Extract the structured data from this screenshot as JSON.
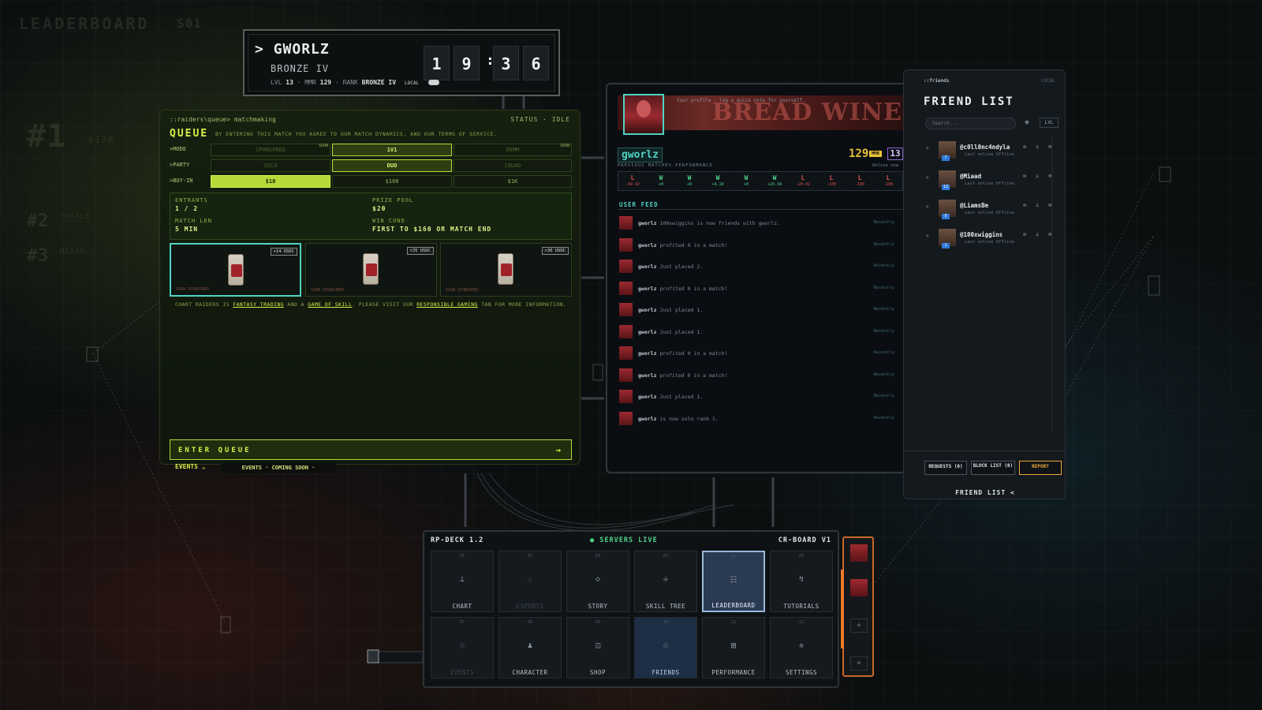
{
  "header": {
    "name": "GWORLZ",
    "rank_title": "BRONZE IV",
    "lvl_label": "LVL",
    "lvl": "13",
    "mmr_label": "MMR",
    "mmr": "129",
    "rank_label": "RANK",
    "rank": "BRONZE IV",
    "clock": [
      "1",
      "9",
      "3",
      "6"
    ],
    "local_label": "LOCAL"
  },
  "queue": {
    "path": "::raiders\\queue> matchmaking",
    "status": "STATUS · IDLE",
    "title": "QUEUE",
    "terms": "BY ENTERING THIS MATCH YOU AGREE TO OUR MATCH DYNAMICS, AND OUR TERMS OF SERVICE.",
    "rows": [
      {
        "label": ">MODE",
        "options": [
          "SPONSORED",
          "1V1",
          "DEMM"
        ],
        "tags": [
          "SOON",
          "",
          "SOON"
        ],
        "selected": 1
      },
      {
        "label": ">PARTY",
        "options": [
          "SOLO",
          "DUO",
          "SQUAD"
        ],
        "tags": [
          "",
          "",
          ""
        ],
        "selected": 1
      },
      {
        "label": ">BUY-IN",
        "options": [
          "$10",
          "$100",
          "$1K"
        ],
        "tags": [
          "",
          "",
          ""
        ],
        "selected": 0
      }
    ],
    "entrants_label": "ENTRANTS",
    "entrants": "1 / 2",
    "prize_label": "PRIZE POOL",
    "prize": "$20",
    "len_label": "MATCH LEN",
    "len": "5 MIN",
    "win_label": "WIN COND",
    "win": "FIRST TO $160 OR MATCH END",
    "cards": [
      {
        "badge": "×14 USDC",
        "tag": "SOON SPONSORED"
      },
      {
        "badge": "×35 USDC",
        "tag": "SOON SPONSORED"
      },
      {
        "badge": "×30 USDC",
        "tag": "SOON SPONSORED"
      }
    ],
    "disclaimer": {
      "p1": "CHART RAIDERS IS ",
      "l1": "FANTASY TRADING",
      "p2": " AND A ",
      "l2": "GAME OF SKILL",
      "p3": ". PLEASE VISIT OUR ",
      "l3": "RESPONSIBLE GAMING",
      "p4": " TAB FOR MORE INFORMATION."
    },
    "enter_label": "ENTER QUEUE",
    "enter_arrow": "→",
    "events_label": "EVENTS ⌄",
    "events_soon": "EVENTS · COMING SOON ·"
  },
  "profile": {
    "note": "Your profile · log a quick note for yourself.",
    "banner_text": "BREAD WINE CIRCUS",
    "username": "gworlz",
    "mmr": "129",
    "mmr_tag": "MMR",
    "level": "13",
    "perf_label": "PREVIOUS MATCHES PERFORMANCE",
    "online": "Online now",
    "matches": [
      {
        "r": "L",
        "d": "-49.42"
      },
      {
        "r": "W",
        "d": "+0"
      },
      {
        "r": "W",
        "d": "+0"
      },
      {
        "r": "W",
        "d": "+4.18"
      },
      {
        "r": "W",
        "d": "+0"
      },
      {
        "r": "W",
        "d": "+29.34"
      },
      {
        "r": "L",
        "d": "-20.42"
      },
      {
        "r": "L",
        "d": "-100"
      },
      {
        "r": "L",
        "d": "-100"
      },
      {
        "r": "L",
        "d": "-100"
      }
    ],
    "feed_title": "USER FEED",
    "feed": [
      {
        "user": "gworlz",
        "text": " 100xwiggins is now friends with gworlz.",
        "when": "Recently"
      },
      {
        "user": "gworlz",
        "text": " profited 0 in a match!",
        "when": "Recently"
      },
      {
        "user": "gworlz",
        "text": " Just placed 2.",
        "when": "Recently"
      },
      {
        "user": "gworlz",
        "text": " profited 0 in a match!",
        "when": "Recently"
      },
      {
        "user": "gworlz",
        "text": " Just placed 1.",
        "when": "Recently"
      },
      {
        "user": "gworlz",
        "text": " Just placed 1.",
        "when": "Recently"
      },
      {
        "user": "gworlz",
        "text": " profited 0 in a match!",
        "when": "Recently"
      },
      {
        "user": "gworlz",
        "text": " profited 0 in a match!",
        "when": "Recently"
      },
      {
        "user": "gworlz",
        "text": " Just placed 1.",
        "when": "Recently"
      },
      {
        "user": "gworlz",
        "text": " is now solo rank 1.",
        "when": "Recently"
      }
    ]
  },
  "friends": {
    "header": "::friends",
    "local": "LOCAL",
    "title": "FRIEND LIST",
    "search_placeholder": "Search...",
    "lvl_button": "LVL",
    "list": [
      {
        "name": "@c0ll0nc4ndyla",
        "status": "Last online Offline",
        "level": "7"
      },
      {
        "name": "@Miaad",
        "status": "Last online Offline",
        "level": "13"
      },
      {
        "name": "@LiamsBe",
        "status": "Last online Offline",
        "level": "9"
      },
      {
        "name": "@100xwiggins",
        "status": "Last online Offline",
        "level": "1"
      }
    ],
    "requests": "REQUESTS (0)",
    "blocklist": "BLOCK LIST (0)",
    "report": "REPORT",
    "footer": "FRIEND LIST <"
  },
  "deck": {
    "left": "RP-DECK 1.2",
    "center": "● SERVERS LIVE",
    "right": "CR-BOARD V1",
    "tiles": [
      {
        "num": "01",
        "label": "CHART",
        "icon": "⊥"
      },
      {
        "num": "02",
        "label": "ESPORTS",
        "icon": "♙"
      },
      {
        "num": "03",
        "label": "STORY",
        "icon": "◇"
      },
      {
        "num": "04",
        "label": "SKILL TREE",
        "icon": "✢"
      },
      {
        "num": "05",
        "label": "LEADERBOARD",
        "icon": "☷"
      },
      {
        "num": "06",
        "label": "TUTORIALS",
        "icon": "↯"
      },
      {
        "num": "07",
        "label": "EVENTS",
        "icon": "◎"
      },
      {
        "num": "08",
        "label": "CHARACTER",
        "icon": "♟"
      },
      {
        "num": "09",
        "label": "SHOP",
        "icon": "◫"
      },
      {
        "num": "10",
        "label": "FRIENDS",
        "icon": "⚇"
      },
      {
        "num": "11",
        "label": "PERFORMANCE",
        "icon": "▤"
      },
      {
        "num": "12",
        "label": "SETTINGS",
        "icon": "✲"
      }
    ]
  },
  "background": {
    "title": "LEADERBOARD",
    "season": "S01",
    "r1": "#1",
    "r1name": "6IXA",
    "r2": "#2",
    "r2name": "TORTLE",
    "r3": "#3",
    "r3name": "MIAAD"
  }
}
